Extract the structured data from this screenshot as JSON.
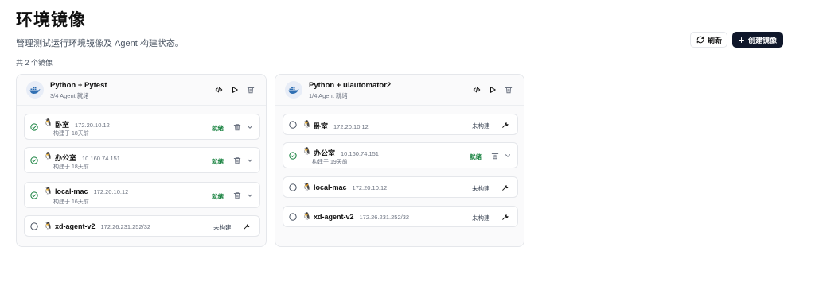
{
  "header": {
    "title": "环境镜像",
    "description": "管理测试运行环境镜像及 Agent 构建状态。",
    "count_text": "共 2 个镜像",
    "refresh_label": "刷新",
    "create_label": "创建镜像"
  },
  "cards": [
    {
      "name": "Python + Pytest",
      "subtitle": "3/4 Agent 就绪",
      "agents": [
        {
          "host": "卧室",
          "ip": "172.20.10.12",
          "built": "构建于 18天前",
          "status": "就绪"
        },
        {
          "host": "办公室",
          "ip": "10.160.74.151",
          "built": "构建于 18天前",
          "status": "就绪"
        },
        {
          "host": "local-mac",
          "ip": "172.20.10.12",
          "built": "构建于 16天前",
          "status": "就绪"
        },
        {
          "host": "xd-agent-v2",
          "ip": "172.26.231.252/32",
          "status": "未构建"
        }
      ]
    },
    {
      "name": "Python + uiautomator2",
      "subtitle": "1/4 Agent 就绪",
      "agents": [
        {
          "host": "卧室",
          "ip": "172.20.10.12",
          "status": "未构建"
        },
        {
          "host": "办公室",
          "ip": "10.160.74.151",
          "built": "构建于 19天前",
          "status": "就绪"
        },
        {
          "host": "local-mac",
          "ip": "172.20.10.12",
          "status": "未构建"
        },
        {
          "host": "xd-agent-v2",
          "ip": "172.26.231.252/32",
          "status": "未构建"
        }
      ]
    }
  ],
  "colors": {
    "ready": "#15803d",
    "primary": "#0f172a",
    "docker": "#2f6fb3"
  },
  "icons": [
    "refresh-icon",
    "plus-icon",
    "docker-icon",
    "code-icon",
    "play-icon",
    "trash-icon",
    "check-circle-icon",
    "empty-circle-icon",
    "linux-icon",
    "chevron-down-icon",
    "wrench-icon"
  ]
}
